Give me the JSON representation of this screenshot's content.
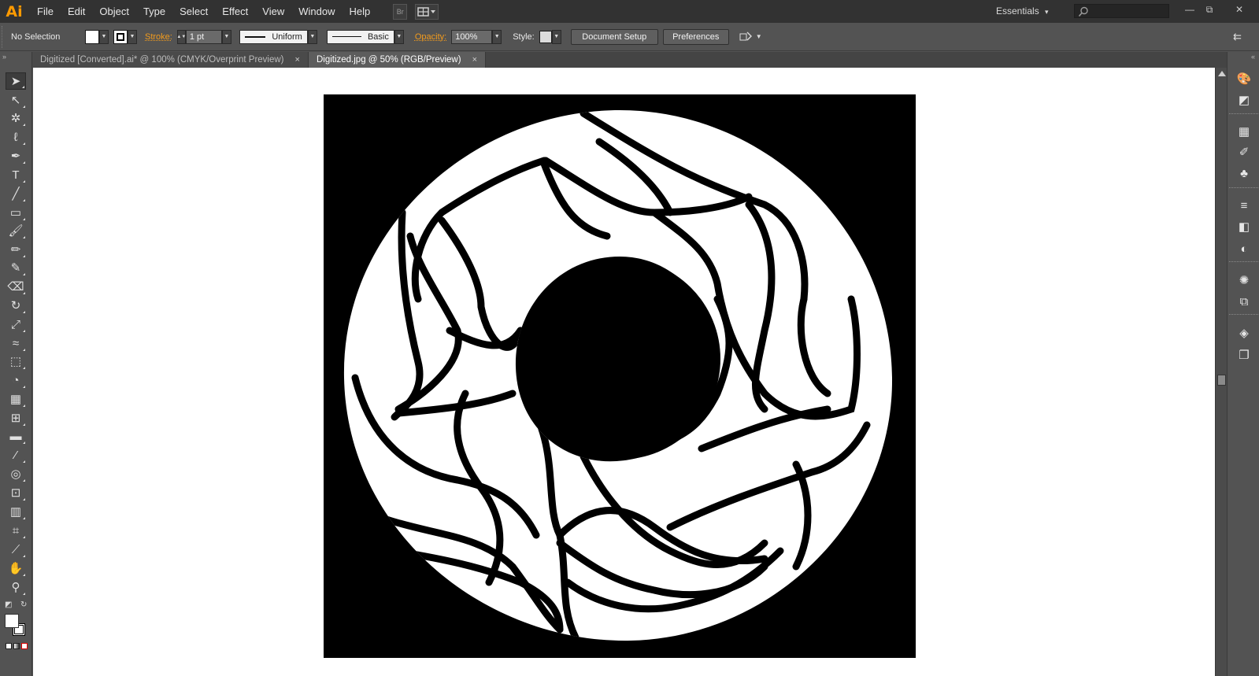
{
  "app": {
    "logo": "Ai"
  },
  "menu": [
    "File",
    "Edit",
    "Object",
    "Type",
    "Select",
    "Effect",
    "View",
    "Window",
    "Help"
  ],
  "menubar": {
    "bridge_label": "Br",
    "workspace": "Essentials",
    "workspace_arrow": "▾"
  },
  "window_controls": {
    "minimize": "—",
    "restore": "⧉",
    "close": "✕"
  },
  "control": {
    "selection": "No Selection",
    "stroke_label": "Stroke:",
    "stroke_weight": "1 pt",
    "profile": "Uniform",
    "brush": "Basic",
    "opacity_label": "Opacity:",
    "opacity_value": "100%",
    "style_label": "Style:",
    "document_setup": "Document Setup",
    "preferences": "Preferences",
    "fill_color": "#ffffff",
    "stroke_color": "#000000"
  },
  "tabs": [
    {
      "label": "Digitized [Converted].ai* @ 100% (CMYK/Overprint Preview)",
      "active": false,
      "close": "×"
    },
    {
      "label": "Digitized.jpg @ 50% (RGB/Preview)",
      "active": true,
      "close": "×"
    }
  ],
  "tools": [
    {
      "name": "selection-tool-icon",
      "glyph": "➤"
    },
    {
      "name": "direct-selection-tool-icon",
      "glyph": "↖"
    },
    {
      "name": "magic-wand-tool-icon",
      "glyph": "✲"
    },
    {
      "name": "lasso-tool-icon",
      "glyph": "ℓ"
    },
    {
      "name": "pen-tool-icon",
      "glyph": "✒"
    },
    {
      "name": "type-tool-icon",
      "glyph": "T"
    },
    {
      "name": "line-segment-tool-icon",
      "glyph": "╱"
    },
    {
      "name": "rectangle-tool-icon",
      "glyph": "▭"
    },
    {
      "name": "paintbrush-tool-icon",
      "glyph": "🖌"
    },
    {
      "name": "pencil-tool-icon",
      "glyph": "✏"
    },
    {
      "name": "blob-brush-tool-icon",
      "glyph": "✎"
    },
    {
      "name": "eraser-tool-icon",
      "glyph": "⌫"
    },
    {
      "name": "rotate-tool-icon",
      "glyph": "↻"
    },
    {
      "name": "scale-tool-icon",
      "glyph": "⤢"
    },
    {
      "name": "warp-tool-icon",
      "glyph": "≈"
    },
    {
      "name": "free-transform-tool-icon",
      "glyph": "⬚"
    },
    {
      "name": "shape-builder-tool-icon",
      "glyph": "◔"
    },
    {
      "name": "perspective-grid-tool-icon",
      "glyph": "▦"
    },
    {
      "name": "mesh-tool-icon",
      "glyph": "⊞"
    },
    {
      "name": "gradient-tool-icon",
      "glyph": "▬"
    },
    {
      "name": "eyedropper-tool-icon",
      "glyph": "⁄"
    },
    {
      "name": "blend-tool-icon",
      "glyph": "◎"
    },
    {
      "name": "symbol-sprayer-tool-icon",
      "glyph": "⊡"
    },
    {
      "name": "column-graph-tool-icon",
      "glyph": "▥"
    },
    {
      "name": "artboard-tool-icon",
      "glyph": "⌗"
    },
    {
      "name": "slice-tool-icon",
      "glyph": "⟋"
    },
    {
      "name": "hand-tool-icon",
      "glyph": "✋"
    },
    {
      "name": "zoom-tool-icon",
      "glyph": "⚲"
    }
  ],
  "dock": [
    {
      "name": "color-panel-icon",
      "glyph": "🎨"
    },
    {
      "name": "color-guide-panel-icon",
      "glyph": "◩"
    },
    {
      "name": "swatches-panel-icon",
      "glyph": "▦"
    },
    {
      "name": "brushes-panel-icon",
      "glyph": "✐"
    },
    {
      "name": "symbols-panel-icon",
      "glyph": "♣"
    },
    {
      "name": "stroke-panel-icon",
      "glyph": "≡"
    },
    {
      "name": "gradient-panel-icon",
      "glyph": "◧"
    },
    {
      "name": "transparency-panel-icon",
      "glyph": "◐"
    },
    {
      "name": "appearance-panel-icon",
      "glyph": "✺"
    },
    {
      "name": "graphic-styles-panel-icon",
      "glyph": "⧉"
    },
    {
      "name": "layers-panel-icon",
      "glyph": "◈"
    },
    {
      "name": "artboards-panel-icon",
      "glyph": "❐"
    }
  ]
}
